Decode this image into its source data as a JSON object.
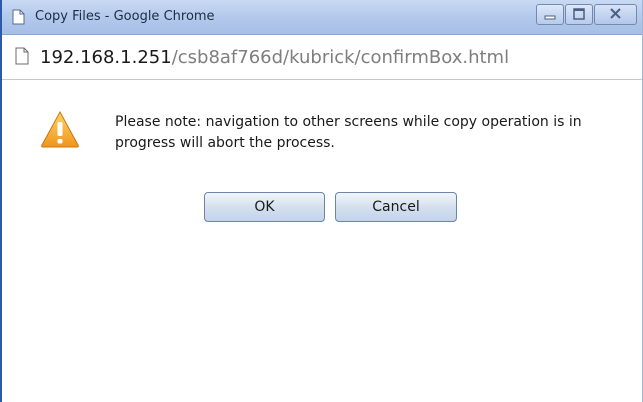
{
  "window": {
    "title": "Copy Files - Google Chrome",
    "controls": [
      "minimize-icon",
      "maximize-icon",
      "close-icon"
    ]
  },
  "address": {
    "host": "192.168.1.251",
    "path": "/csb8af766d/kubrick/confirmBox.html"
  },
  "dialog": {
    "icon": "warning-icon",
    "message": "Please note: navigation to other screens while copy operation is in progress will abort the process.",
    "ok_label": "OK",
    "cancel_label": "Cancel"
  },
  "colors": {
    "titlebar": "#b3c9ec",
    "warning": "#f0a22c",
    "button": "#d4e0ef"
  }
}
